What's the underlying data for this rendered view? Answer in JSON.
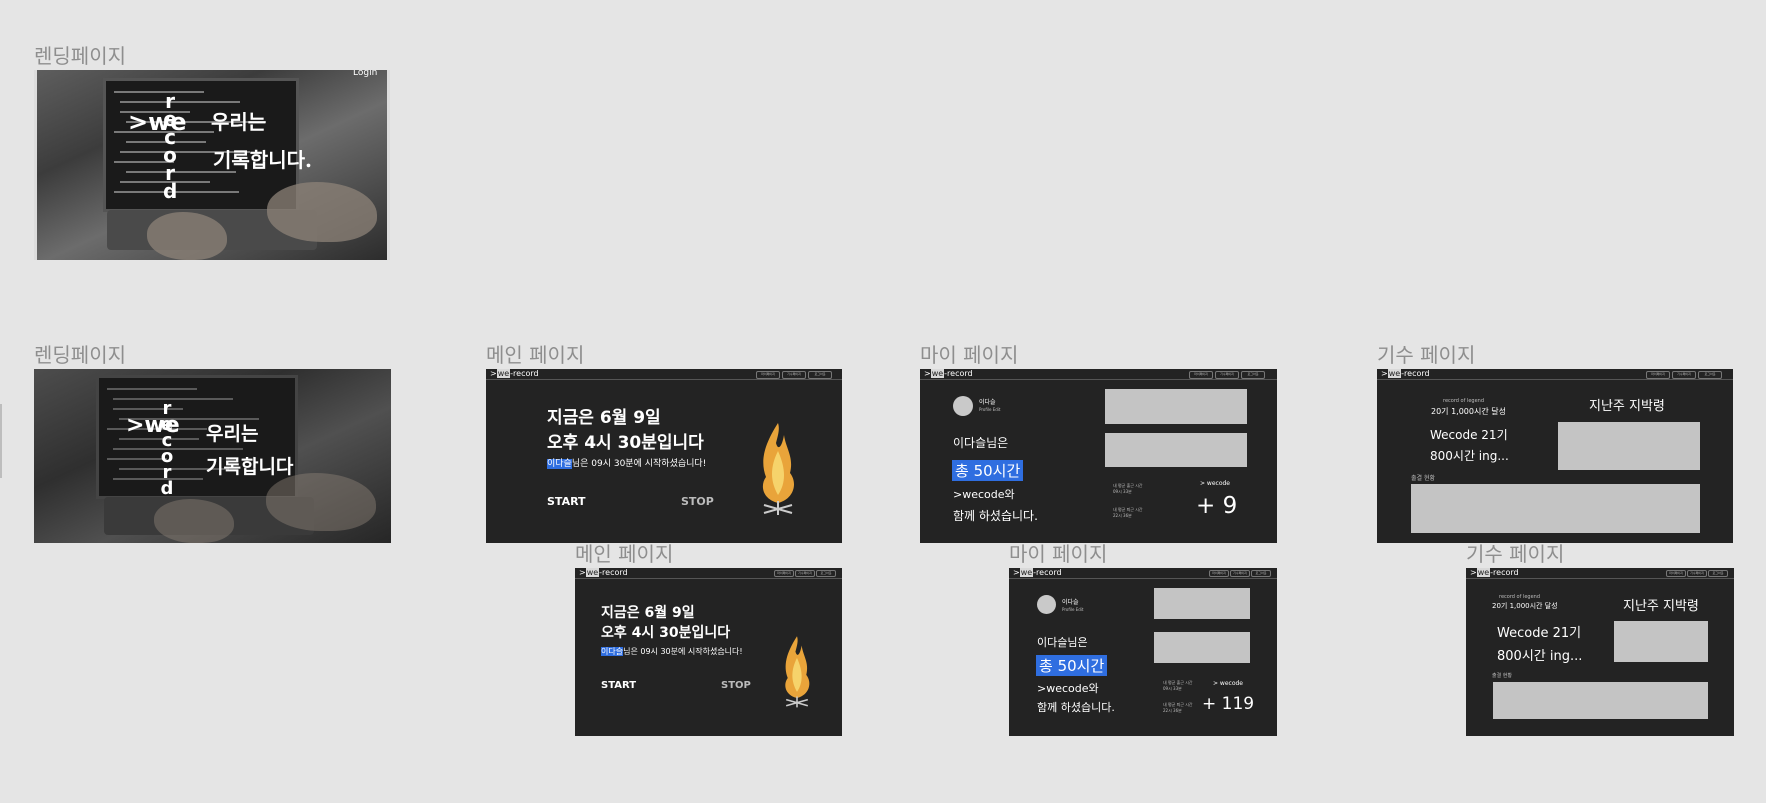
{
  "labels": {
    "landing_top": "렌딩페이지",
    "landing": "렌딩페이지",
    "main": "메인 페이지",
    "my": "마이 페이지",
    "cohort": "기수 페이지"
  },
  "landing": {
    "brand_prefix": ">we",
    "brand_vertical": "record",
    "slogan_line1": "우리는",
    "slogan_line2_top": "기록합니다.",
    "slogan_line2": "기록합니다",
    "login": "Login"
  },
  "nav": {
    "brand_prefix": ">",
    "brand_we": "we",
    "brand_suffix": "-record",
    "buttons": [
      "마이페이지",
      "기수페이지",
      "로그아웃"
    ]
  },
  "main_page": {
    "date_line": "지금은 6월 9일",
    "time_line": "오후 4시 30분입니다",
    "user_name": "이다슬",
    "start_msg": "님은 09시 30분에 시작하셨습니다!",
    "start": "START",
    "stop": "STOP",
    "icon": "campfire-icon"
  },
  "my_page": {
    "avatar_name": "이다슬",
    "avatar_sub": "Profile Edit",
    "user_label": "이다슬님은",
    "total_time": "총 50시간",
    "with_line": ">wecode와",
    "done_line": "함께 하셨습니다.",
    "avg_in_label": "내 평균 출근 시간",
    "avg_in_value": "09시 33분",
    "avg_out_label": "내 평균 퇴근 시간",
    "avg_out_value": "22시 36분",
    "wecode_label": "> wecode",
    "wecode_count_a": "+ 9",
    "wecode_count_b": "+ 119"
  },
  "cohort_page": {
    "legend_label": "record of legend",
    "legend_value": "20기 1,000시간 달성",
    "cohort_name": "Wecode 21기",
    "cohort_hours": "800시간 ing...",
    "last_week": "지난주 지박령",
    "status": "출결 현황"
  },
  "colors": {
    "background": "#e5e5e5",
    "frame": "#232323",
    "highlight": "#2f6ee0",
    "placeholder": "#c4c4c4"
  }
}
